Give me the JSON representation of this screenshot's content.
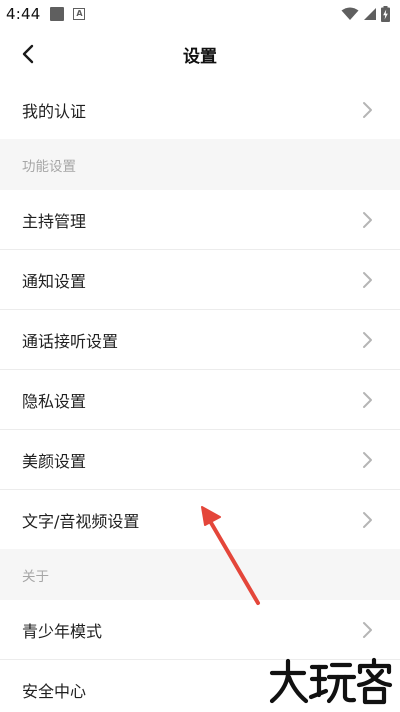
{
  "status_bar": {
    "time": "4:44",
    "icons": [
      "notification-square-icon",
      "a-badge-icon",
      "wifi-icon",
      "signal-icon",
      "battery-charging-icon"
    ]
  },
  "header": {
    "title": "设置",
    "back_icon": "chevron-left-icon"
  },
  "rows_top": [
    {
      "label": "我的认证"
    }
  ],
  "sections": [
    {
      "title": "功能设置",
      "items": [
        {
          "label": "主持管理"
        },
        {
          "label": "通知设置"
        },
        {
          "label": "通话接听设置"
        },
        {
          "label": "隐私设置"
        },
        {
          "label": "美颜设置"
        },
        {
          "label": "文字/音视频设置"
        }
      ]
    },
    {
      "title": "关于",
      "items": [
        {
          "label": "青少年模式"
        },
        {
          "label": "安全中心"
        }
      ]
    }
  ],
  "annotation": {
    "arrow_color": "#e4463a"
  },
  "watermark_icon": "brand-watermark-icon",
  "colors": {
    "section_bg": "#f6f6f6",
    "section_text": "#a6a6a6",
    "chevron": "#b5b5b5"
  }
}
